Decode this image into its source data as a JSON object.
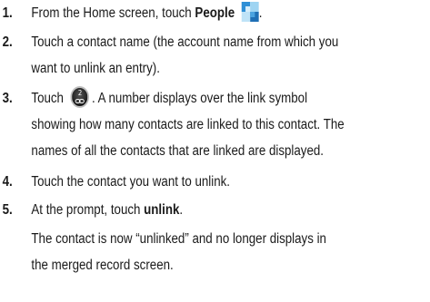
{
  "steps": [
    {
      "number": "1.",
      "lines": [
        {
          "before": "From the Home screen, touch ",
          "bold": "People",
          "after": "",
          "icon": "people-icon",
          "end": "."
        }
      ]
    },
    {
      "number": "2.",
      "lines": [
        {
          "text": "Touch a contact name (the account name from which you"
        },
        {
          "text": "want to unlink an entry)."
        }
      ]
    },
    {
      "number": "3.",
      "lines": [
        {
          "before": "Touch",
          "icon": "link-icon",
          "icon_number": "2",
          "after": ". A number displays over the link symbol"
        },
        {
          "text": "showing how many contacts are linked to this contact. The"
        },
        {
          "text": "names of all the contacts that are linked are displayed."
        }
      ]
    },
    {
      "number": "4.",
      "lines": [
        {
          "text": "Touch the contact you want to unlink."
        }
      ]
    },
    {
      "number": "5.",
      "lines": [
        {
          "before": "At the prompt, touch ",
          "bold": "unlink",
          "after": "."
        }
      ]
    }
  ],
  "note": {
    "lines": [
      {
        "text": "The contact is now “unlinked” and no longer displays in"
      },
      {
        "text": "the merged record screen."
      }
    ]
  }
}
